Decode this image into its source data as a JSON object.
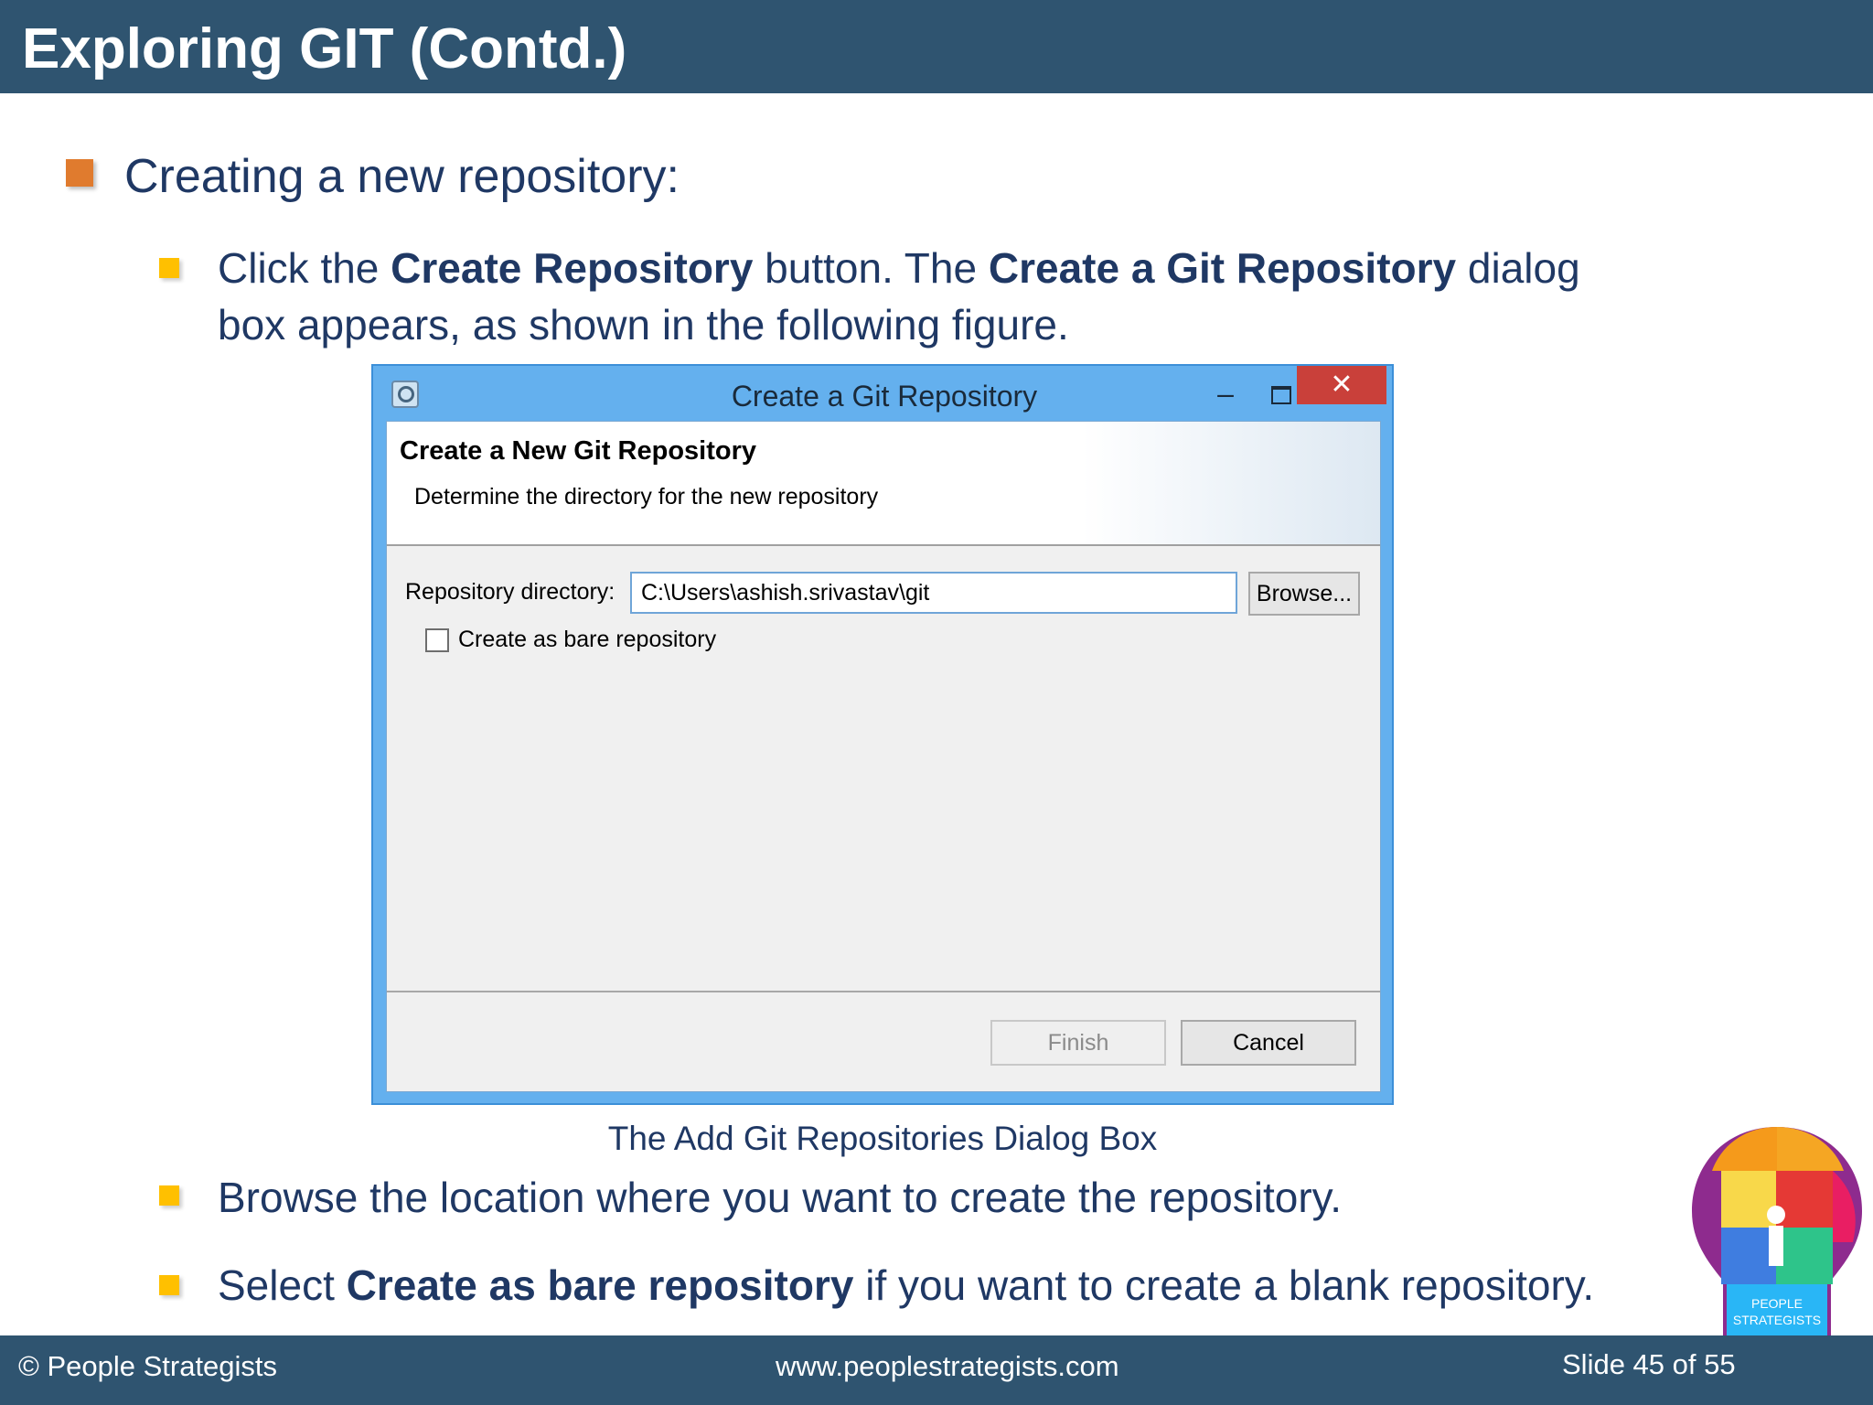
{
  "header": {
    "title": "Exploring GIT (Contd.)"
  },
  "content": {
    "level1": "Creating a new repository:",
    "bullet1": {
      "pre": "Click the ",
      "b1": "Create Repository",
      "mid": " button. The ",
      "b2": "Create a Git Repository",
      "post": " dialog box appears, as shown in the following figure."
    },
    "bullet2": "Browse the location where you want to create the repository.",
    "bullet3": {
      "pre": "Select ",
      "bold": "Create as bare repository",
      "post": " if you want to create a blank repository."
    }
  },
  "dialog": {
    "title": "Create a Git Repository",
    "minimize_glyph": "–",
    "close_glyph": "✕",
    "banner_title": "Create a New Git Repository",
    "banner_subtitle": "Determine the directory for the new repository",
    "repo_label": "Repository directory:",
    "repo_value": "C:\\Users\\ashish.srivastav\\git",
    "browse_label": "Browse...",
    "checkbox_label": "Create as bare repository",
    "finish_label": "Finish",
    "cancel_label": "Cancel"
  },
  "caption": "The Add Git Repositories Dialog Box",
  "logo": {
    "line1": "PEOPLE",
    "line2": "STRATEGISTS"
  },
  "footer": {
    "left": "© People Strategists",
    "center": "www.peoplestrategists.com",
    "right": "Slide 45 of 55"
  },
  "colors": {
    "header_bg": "#2f5470",
    "text_primary": "#1f3864",
    "bullet_l1": "#e07b2e",
    "bullet_l2": "#ffc000",
    "dialog_frame": "#64b0ee",
    "close_button": "#c9403a"
  }
}
